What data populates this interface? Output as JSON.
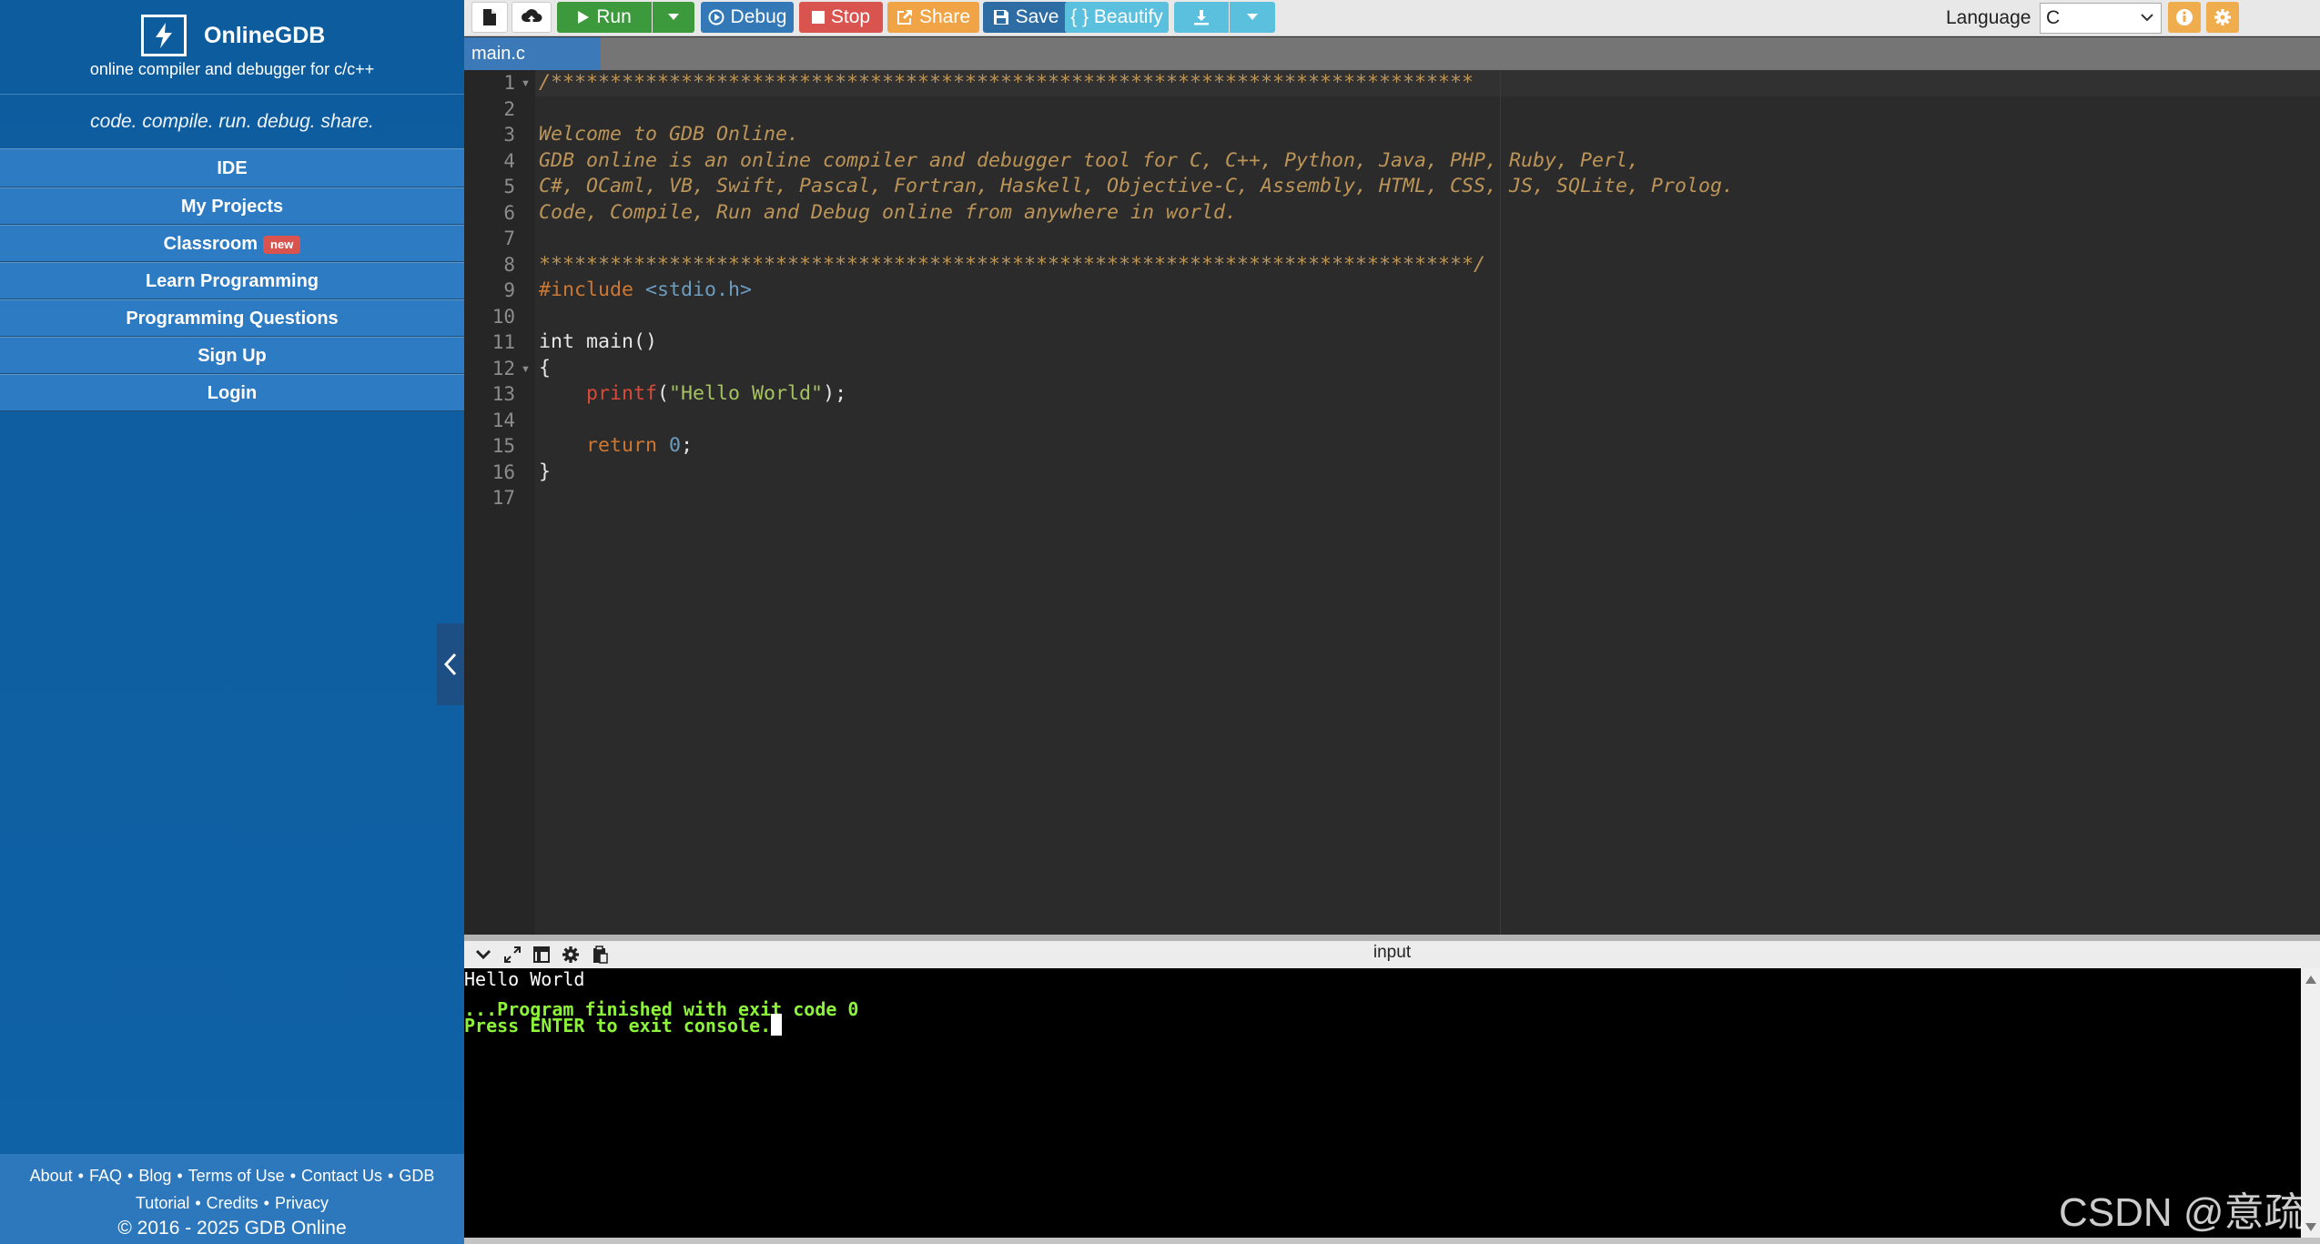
{
  "brand": {
    "name": "OnlineGDB",
    "subtitle": "online compiler and debugger for c/c++",
    "tagline": "code. compile. run. debug. share."
  },
  "nav": {
    "ide": "IDE",
    "projects": "My Projects",
    "classroom": "Classroom",
    "classroom_badge": "new",
    "learn": "Learn Programming",
    "questions": "Programming Questions",
    "signup": "Sign Up",
    "login": "Login"
  },
  "footer": {
    "about": "About",
    "faq": "FAQ",
    "blog": "Blog",
    "terms": "Terms of Use",
    "contact": "Contact Us",
    "gdb": "GDB",
    "tutorial": "Tutorial",
    "credits": "Credits",
    "privacy": "Privacy",
    "copyright": "© 2016 - 2025 GDB Online",
    "separator": "•"
  },
  "toolbar": {
    "run": "Run",
    "debug": "Debug",
    "stop": "Stop",
    "share": "Share",
    "save": "Save",
    "beautify": "{ } Beautify",
    "language_label": "Language",
    "language_value": "C"
  },
  "colors": {
    "run": "#3c9a3c",
    "debug": "#3379b7",
    "stop": "#d9534f",
    "share": "#f0a446",
    "save": "#2e6da4",
    "beautify": "#5bc0de",
    "download": "#5bc0de",
    "info": "#f0ad4e",
    "settings": "#f0ad4e"
  },
  "editor": {
    "tab": "main.c",
    "line_numbers": [
      "1",
      "2",
      "3",
      "4",
      "5",
      "6",
      "7",
      "8",
      "9",
      "10",
      "11",
      "12",
      "13",
      "14",
      "15",
      "16",
      "17"
    ],
    "lines": {
      "l1": "/******************************************************************************",
      "l3": "Welcome to GDB Online.",
      "l4": "GDB online is an online compiler and debugger tool for C, C++, Python, Java, PHP, Ruby, Perl,",
      "l5": "C#, OCaml, VB, Swift, Pascal, Fortran, Haskell, Objective-C, Assembly, HTML, CSS, JS, SQLite, Prolog.",
      "l6": "Code, Compile, Run and Debug online from anywhere in world.",
      "l8": "*******************************************************************************/",
      "l9_directive": "#include ",
      "l9_header": "<stdio.h>",
      "l11": "int main()",
      "l12": "{",
      "l13_indent": "    ",
      "l13_fn": "printf",
      "l13_open": "(",
      "l13_str": "\"Hello World\"",
      "l13_close": ");",
      "l15_indent": "    ",
      "l15_kw": "return",
      "l15_space": " ",
      "l15_num": "0",
      "l15_semi": ";",
      "l16": "}"
    }
  },
  "console": {
    "label": "input",
    "output": "Hello World",
    "finished": "...Program finished with exit code 0",
    "prompt": "Press ENTER to exit console."
  },
  "watermark": "CSDN @意疏"
}
